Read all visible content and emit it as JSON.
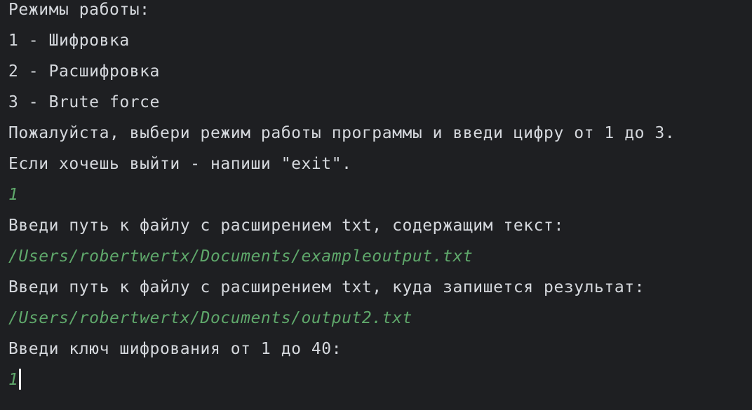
{
  "console": {
    "lines": [
      {
        "text": "Режимы работы:",
        "kind": "output"
      },
      {
        "text": "1 - Шифровка",
        "kind": "output"
      },
      {
        "text": "2 - Расшифровка",
        "kind": "output"
      },
      {
        "text": "3 - Brute force",
        "kind": "output"
      },
      {
        "text": "Пожалуйста, выбери режим работы программы и введи цифру от 1 до 3.",
        "kind": "output"
      },
      {
        "text": "Если хочешь выйти - напиши \"exit\".",
        "kind": "output"
      },
      {
        "text": "1",
        "kind": "input"
      },
      {
        "text": "Введи путь к файлу с расширением txt, содержащим текст:",
        "kind": "output"
      },
      {
        "text": "/Users/robertwertx/Documents/exampleoutput.txt",
        "kind": "input"
      },
      {
        "text": "Введи путь к файлу с расширением txt, куда запишется результат:",
        "kind": "output"
      },
      {
        "text": "/Users/robertwertx/Documents/output2.txt",
        "kind": "input"
      },
      {
        "text": "Введи ключ шифрования от 1 до 40:",
        "kind": "output"
      },
      {
        "text": "1",
        "kind": "input"
      }
    ]
  },
  "colors": {
    "background": "#1e1f22",
    "output_text": "#d5d8dd",
    "input_text": "#5fa86b",
    "caret": "#f2f2f2"
  }
}
